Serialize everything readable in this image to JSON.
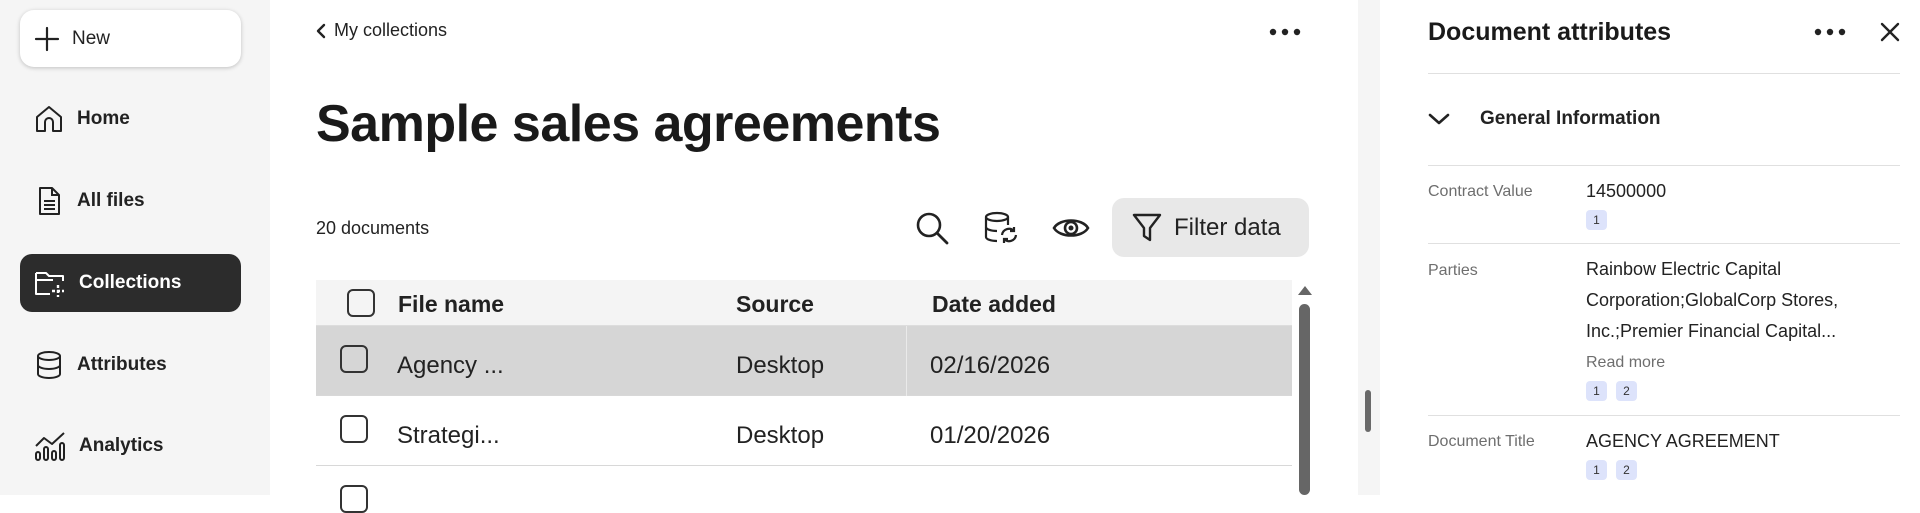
{
  "sidebar": {
    "new_label": "New",
    "items": [
      {
        "label": "Home",
        "icon": "home-icon"
      },
      {
        "label": "All files",
        "icon": "file-icon"
      },
      {
        "label": "Collections",
        "icon": "folder-collection-icon",
        "active": true
      },
      {
        "label": "Attributes",
        "icon": "database-icon"
      },
      {
        "label": "Analytics",
        "icon": "chart-icon"
      }
    ]
  },
  "main": {
    "back_label": "My collections",
    "title": "Sample sales agreements",
    "doc_count": "20 documents",
    "filter_label": "Filter data",
    "table": {
      "columns": [
        "File name",
        "Source",
        "Date added"
      ],
      "rows": [
        {
          "file": "Agency ...",
          "source": "Desktop",
          "date": "02/16/2026",
          "selected": true
        },
        {
          "file": "Strategi...",
          "source": "Desktop",
          "date": "01/20/2026",
          "selected": false
        }
      ]
    }
  },
  "panel": {
    "title": "Document attributes",
    "section": "General Information",
    "attributes": [
      {
        "label": "Contract Value",
        "value": "14500000",
        "badges": [
          "1"
        ]
      },
      {
        "label": "Parties",
        "value_lines": [
          "Rainbow Electric Capital",
          "Corporation;GlobalCorp Stores,",
          "Inc.;Premier Financial Capital..."
        ],
        "read_more": "Read more",
        "badges": [
          "1",
          "2"
        ]
      },
      {
        "label": "Document Title",
        "value": "AGENCY AGREEMENT",
        "badges": [
          "1",
          "2"
        ]
      }
    ]
  },
  "colors": {
    "active_nav_bg": "#2c2c2c",
    "selected_row_bg": "#d6d6d6",
    "badge_bg": "#dde3fb"
  }
}
